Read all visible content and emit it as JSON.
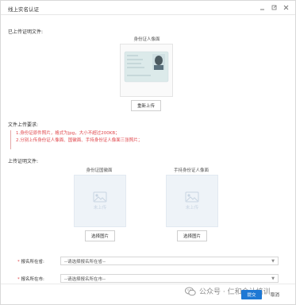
{
  "window": {
    "title": "线上实名认证"
  },
  "uploaded_section": {
    "label": "已上传证明文件:",
    "photo_label": "身份证人像面",
    "reupload_button": "重新上传"
  },
  "requirements": {
    "label": "文件上传要求:",
    "lines": [
      "1.身份证原件照片，格式为jpg，大小不超过200KB；",
      "2.分别上传身份证人像面、国徽面、手持身份证人像面三张照片；"
    ]
  },
  "upload_section": {
    "label": "上传证明文件:",
    "boxes": [
      {
        "title": "身份证国徽面",
        "placeholder": "未上传",
        "button": "选择图片"
      },
      {
        "title": "手持身份证人像面",
        "placeholder": "未上传",
        "button": "选择图片"
      }
    ]
  },
  "form": {
    "province": {
      "label": "报名所在省:",
      "placeholder": "--请选择报名所在省--"
    },
    "city": {
      "label": "报名所在市:",
      "placeholder": "--请选择报名所在市--"
    }
  },
  "footer": {
    "submit": "提交",
    "cancel": "取消"
  },
  "watermark": {
    "text": "公众号 · 仁和会计培训"
  },
  "colors": {
    "accent": "#1e78d4",
    "warning": "#e0474c"
  }
}
